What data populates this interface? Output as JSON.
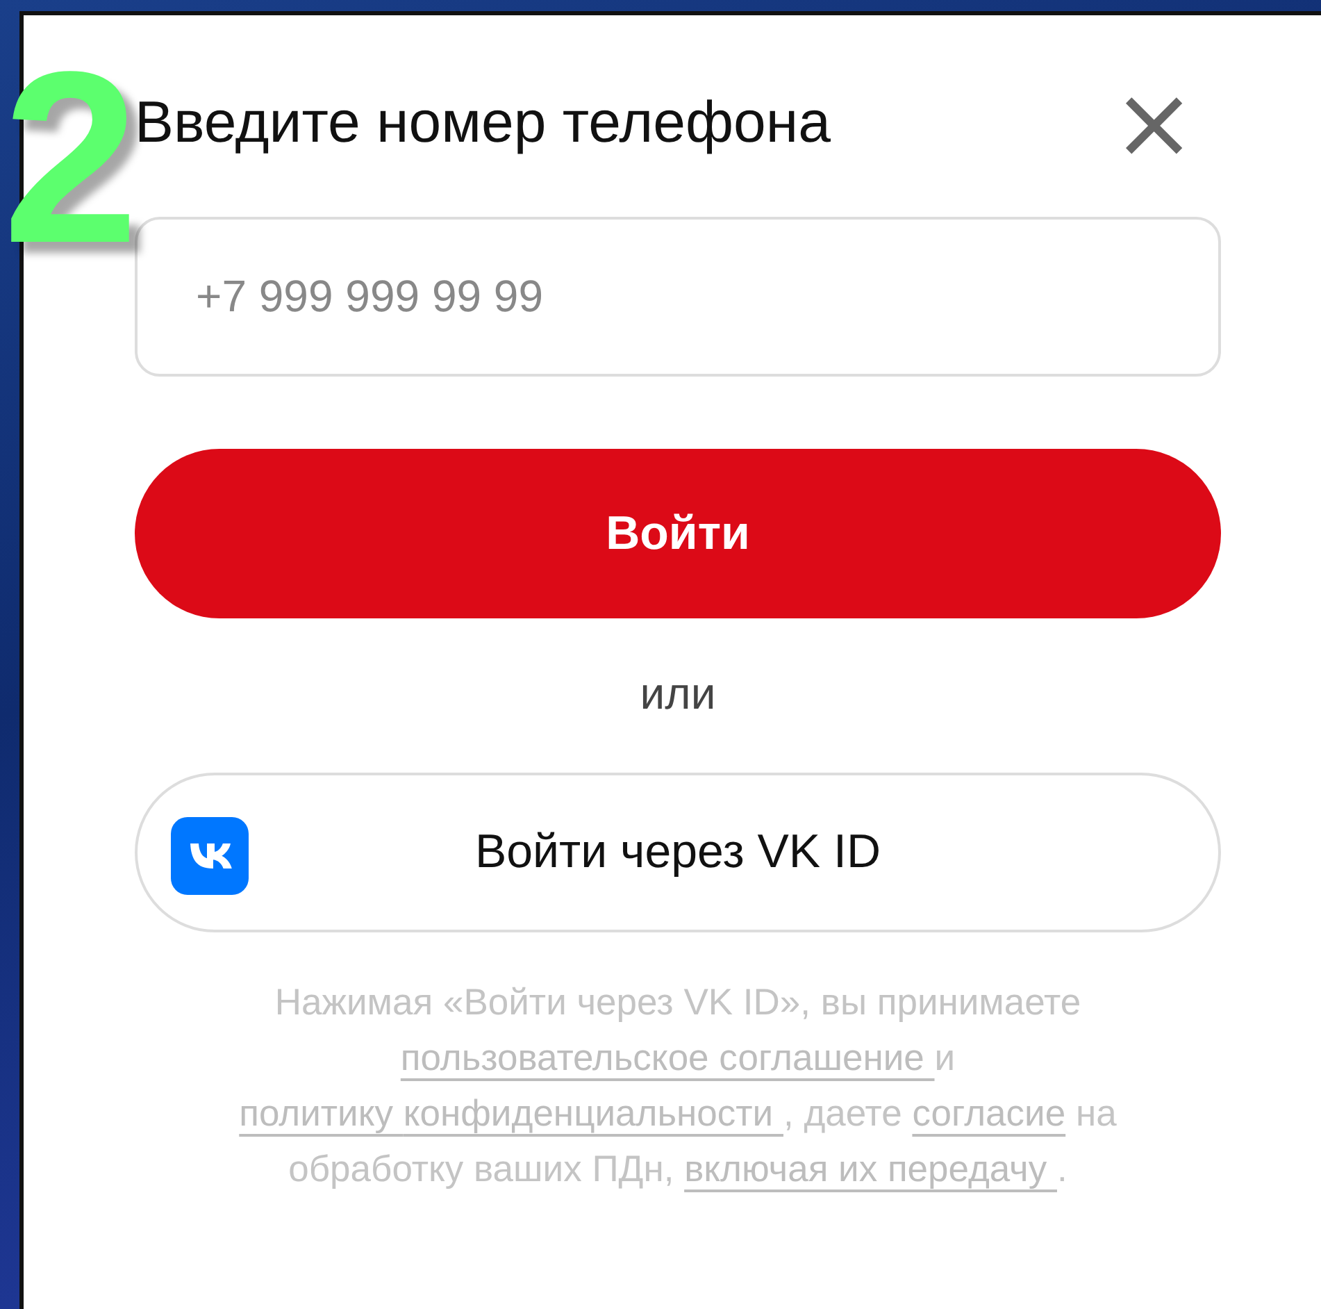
{
  "step_number": "2",
  "dialog": {
    "title": "Введите номер телефона",
    "close": "×"
  },
  "phone_field": {
    "placeholder": "+7 999 999 99 99"
  },
  "login_button": "Войти",
  "separator": "или",
  "vk_button": "Войти через VK ID",
  "legal": [
    {
      "kind": "plain",
      "text": "Нажимая «Войти через VK ID», вы принимаете "
    },
    {
      "kind": "link",
      "text": "пользовательское соглашение "
    },
    {
      "kind": "plain",
      "text": " и "
    },
    {
      "kind": "link",
      "text": "политику "
    },
    {
      "kind": "link",
      "text": "конфиденциальности "
    },
    {
      "kind": "plain",
      "text": ", даете "
    },
    {
      "kind": "link",
      "text": "согласие"
    },
    {
      "kind": "plain",
      "text": " на обработку ваших ПДн, "
    },
    {
      "kind": "link",
      "text": "включая их передачу "
    },
    {
      "kind": "plain",
      "text": "."
    }
  ]
}
